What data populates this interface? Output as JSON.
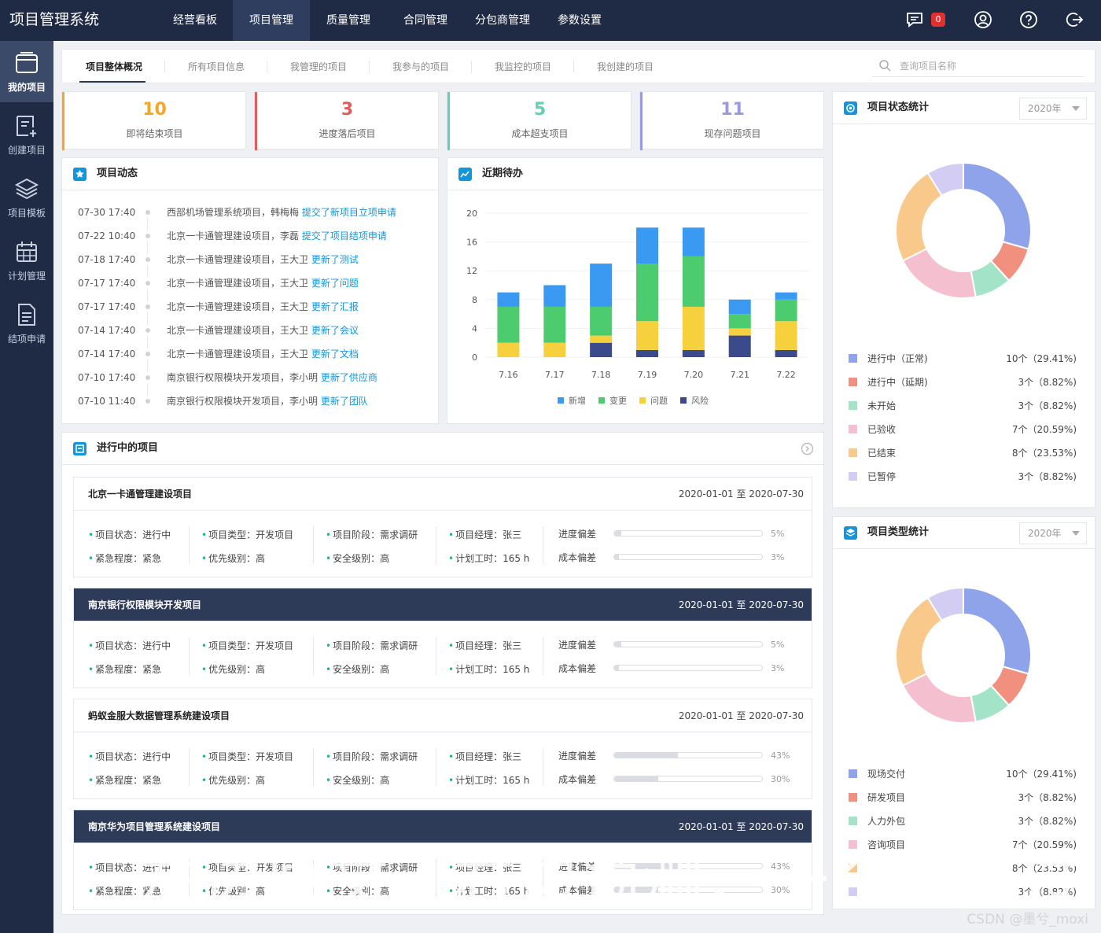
{
  "app": {
    "title": "项目管理系统"
  },
  "top_nav": [
    "经营看板",
    "项目管理",
    "质量管理",
    "合同管理",
    "分包商管理",
    "参数设置"
  ],
  "top_nav_active": 1,
  "notifications": {
    "count": "0"
  },
  "sidebar": [
    {
      "label": "我的项目",
      "icon": "project-card-icon"
    },
    {
      "label": "创建项目",
      "icon": "create-project-icon"
    },
    {
      "label": "项目模板",
      "icon": "layers-icon"
    },
    {
      "label": "计划管理",
      "icon": "calendar-icon"
    },
    {
      "label": "结项申请",
      "icon": "document-icon"
    }
  ],
  "tabs": [
    "项目整体概况",
    "所有项目信息",
    "我管理的项目",
    "我参与的项目",
    "我监控的项目",
    "我创建的项目"
  ],
  "search": {
    "placeholder": "查询项目名称"
  },
  "stats": [
    {
      "value": "10",
      "label": "即将结束项目",
      "color": "#f5a623"
    },
    {
      "value": "3",
      "label": "进度落后项目",
      "color": "#e35b5b"
    },
    {
      "value": "5",
      "label": "成本超支项目",
      "color": "#5fd0b0"
    },
    {
      "value": "11",
      "label": "现存问题项目",
      "color": "#9a9ae0"
    }
  ],
  "activity": {
    "title": "项目动态",
    "items": [
      {
        "time": "07-30 17:40",
        "text": "西部机场管理系统项目，韩梅梅",
        "link": "提交了新项目立项申请"
      },
      {
        "time": "07-22 10:40",
        "text": "北京一卡通管理建设项目，李磊",
        "link": "提交了项目结项申请"
      },
      {
        "time": "07-18 17:40",
        "text": "北京一卡通管理建设项目，王大卫",
        "link": "更新了测试"
      },
      {
        "time": "07-17 17:40",
        "text": "北京一卡通管理建设项目，王大卫",
        "link": "更新了问题"
      },
      {
        "time": "07-17 17:40",
        "text": "北京一卡通管理建设项目，王大卫",
        "link": "更新了汇报"
      },
      {
        "time": "07-14 17:40",
        "text": "北京一卡通管理建设项目，王大卫",
        "link": "更新了会议"
      },
      {
        "time": "07-14 17:40",
        "text": "北京一卡通管理建设项目，王大卫",
        "link": "更新了文档"
      },
      {
        "time": "07-10 17:40",
        "text": "南京银行权限模块开发项目，李小明",
        "link": "更新了供应商"
      },
      {
        "time": "07-10 11:40",
        "text": "南京银行权限模块开发项目，李小明",
        "link": "更新了团队"
      }
    ]
  },
  "todo": {
    "title": "近期待办"
  },
  "chart_data": [
    {
      "type": "bar",
      "stacked": true,
      "categories": [
        "7.16",
        "7.17",
        "7.18",
        "7.19",
        "7.20",
        "7.21",
        "7.22"
      ],
      "series": [
        {
          "name": "风险",
          "color": "#3b4a8a",
          "values": [
            0,
            0,
            2,
            1,
            1,
            3,
            1
          ]
        },
        {
          "name": "问题",
          "color": "#f7d13d",
          "values": [
            2,
            2,
            1,
            4,
            6,
            1,
            4
          ]
        },
        {
          "name": "变更",
          "color": "#4ccc6e",
          "values": [
            5,
            5,
            4,
            8,
            7,
            2,
            3
          ]
        },
        {
          "name": "新增",
          "color": "#3a9af2",
          "values": [
            2,
            3,
            6,
            5,
            4,
            2,
            1
          ]
        }
      ],
      "legend_order": [
        "新增",
        "变更",
        "问题",
        "风险"
      ],
      "ylim": [
        0,
        20
      ],
      "yticks": [
        0,
        4,
        8,
        12,
        16,
        20
      ],
      "legend_position": "bottom"
    },
    {
      "type": "pie",
      "donut": true,
      "title": "项目状态统计",
      "labels": [
        "进行中（正常)",
        "进行中（延期)",
        "未开始",
        "已验收",
        "已结束",
        "已暂停"
      ],
      "values": [
        10,
        3,
        3,
        7,
        8,
        3
      ],
      "value_labels": [
        "10个（29.41%)",
        "3个（8.82%)",
        "3个（8.82%)",
        "7个（20.59%)",
        "8个（23.53%)",
        "3个（8.82%)"
      ],
      "colors": [
        "#8fa3ea",
        "#f2907f",
        "#a3e3c8",
        "#f4c0d0",
        "#f9c98c",
        "#d4cdf3"
      ]
    },
    {
      "type": "pie",
      "donut": true,
      "title": "项目类型统计",
      "labels": [
        "现场交付",
        "研发项目",
        "人力外包",
        "咨询项目",
        "",
        ""
      ],
      "values": [
        10,
        3,
        3,
        7,
        8,
        3
      ],
      "value_labels": [
        "10个（29.41%)",
        "3个（8.82%)",
        "3个（8.82%)",
        "7个（20.59%)",
        "8个（23.53%)",
        "3个（8.82%)"
      ],
      "colors": [
        "#8fa3ea",
        "#f2907f",
        "#a3e3c8",
        "#f4c0d0",
        "#f9c98c",
        "#d4cdf3"
      ]
    }
  ],
  "status_panel": {
    "title": "项目状态统计",
    "year": "2020年"
  },
  "type_panel": {
    "title": "项目类型统计",
    "year": "2020年"
  },
  "ongoing": {
    "title": "进行中的项目",
    "projects": [
      {
        "name": "北京一卡通管理建设项目",
        "dates": "2020-01-01 至 2020-07-30",
        "status": "项目状态：进行中",
        "urgency": "紧急程度：紧急",
        "type": "项目类型：开发项目",
        "priority": "优先级别：高",
        "stage": "项目阶段：需求调研",
        "security": "安全级别：高",
        "manager": "项目经理：张三",
        "hours": "计划工时：165 h",
        "progress_label": "进度偏差",
        "cost_label": "成本偏差",
        "progress_dev": "5%",
        "cost_dev": "3%",
        "progress_value": 5,
        "cost_value": 3,
        "dark": false
      },
      {
        "name": "南京银行权限模块开发项目",
        "dates": "2020-01-01 至 2020-07-30",
        "status": "项目状态：进行中",
        "urgency": "紧急程度：紧急",
        "type": "项目类型：开发项目",
        "priority": "优先级别：高",
        "stage": "项目阶段：需求调研",
        "security": "安全级别：高",
        "manager": "项目经理：张三",
        "hours": "计划工时：165 h",
        "progress_label": "进度偏差",
        "cost_label": "成本偏差",
        "progress_dev": "5%",
        "cost_dev": "3%",
        "progress_value": 5,
        "cost_value": 3,
        "dark": true
      },
      {
        "name": "蚂蚁金服大数据管理系统建设项目",
        "dates": "2020-01-01 至 2020-07-30",
        "status": "项目状态：进行中",
        "urgency": "紧急程度：紧急",
        "type": "项目类型：开发项目",
        "priority": "优先级别：高",
        "stage": "项目阶段：需求调研",
        "security": "安全级别：高",
        "manager": "项目经理：张三",
        "hours": "计划工时：165 h",
        "progress_label": "进度偏差",
        "cost_label": "成本偏差",
        "progress_dev": "43%",
        "cost_dev": "30%",
        "progress_value": 43,
        "cost_value": 30,
        "dark": false
      },
      {
        "name": "南京华为项目管理系统建设项目",
        "dates": "2020-01-01 至 2020-07-30",
        "status": "项目状态：进行中",
        "urgency": "紧急程度：紧急",
        "type": "项目类型：开发项目",
        "priority": "优先级别：高",
        "stage": "项目阶段：需求调研",
        "security": "安全级别：高",
        "manager": "项目经理：张三",
        "hours": "计划工时：165 h",
        "progress_label": "进度偏差",
        "cost_label": "成本偏差",
        "progress_dev": "43%",
        "cost_dev": "30%",
        "progress_value": 43,
        "cost_value": 30,
        "dark": true
      }
    ]
  },
  "overlay_caption": "左边原文，右边预测，一个键通过",
  "watermark": "CSDN @墨兮_moxi"
}
